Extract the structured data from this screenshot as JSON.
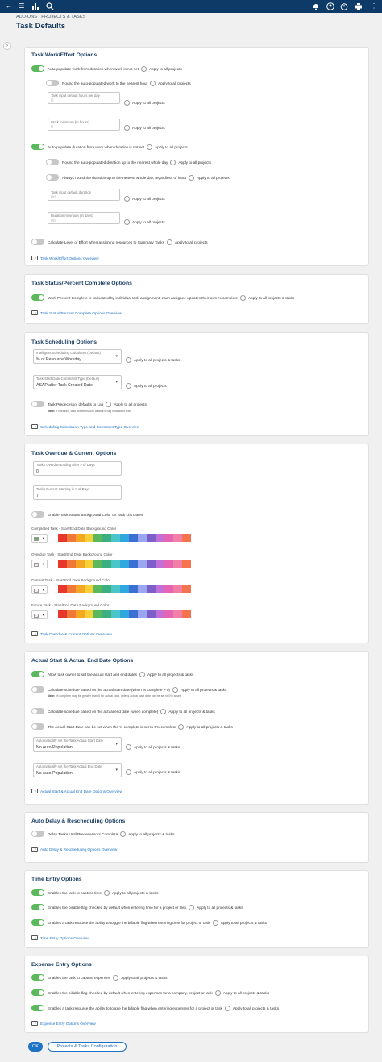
{
  "header": {
    "breadcrumb": "ADD-ONS · PROJECTS & TASKS",
    "title": "Task Defaults"
  },
  "apply_all": "Apply to all projects",
  "apply_all_tasks": "Apply to all projects & tasks",
  "work_effort": {
    "title": "Task Work/Effort Options",
    "auto_work": "Auto-populate work from duration when work is not set",
    "round_work": "Round the auto-populated work to the nearest hour",
    "hours_per_day_label": "Task input default hours per day",
    "hours_per_day_value": "8",
    "work_min_label": "Work minimum (in hours)",
    "work_min_value": "0",
    "auto_duration": "Auto-populate duration from work when duration is not set",
    "round_duration": "Round the auto-populated duration up to the nearest whole day",
    "always_round": "Always round the duration up to the nearest whole day, regardless of input",
    "default_duration_label": "Task input default duration",
    "default_duration_value": "0d",
    "duration_min_label": "Duration minimum (in days)",
    "duration_min_value": "0d",
    "loe": "Calculate Level of Effort when assigning resources to Summary Tasks",
    "overview": "Task Work/Effort Options Overview"
  },
  "status": {
    "title": "Task Status/Percent Complete Options",
    "work_percent": "Work Percent Complete is calculated by individual task assignment, each assignee updates their own % complete",
    "overview": "Task Status/Percent Complete Options Overview"
  },
  "scheduling": {
    "title": "Task Scheduling Options",
    "calc_label": "Intelligent Scheduling Calculates (Default)",
    "calc_value": "% of Resource Workday",
    "constraint_label": "Task Start Date Constraint Type (Default)",
    "constraint_value": "ASAP after Task Created Date",
    "predecessor": "Task Predecessor defaults to Lag",
    "note_label": "Note:",
    "note_text": "If checked, task predecessors default to lag instead of lead",
    "overview": "Scheduling Calculation Type and Constraint Type Overview"
  },
  "overdue": {
    "title": "Task Overdue & Current Options",
    "overdue_label": "Tasks Overdue Ending After # of Days",
    "overdue_value": "0",
    "current_label": "Tasks Current Starting in # of Days",
    "current_value": "7",
    "bg_color": "Enable Task Status Background Color on Task List Dates",
    "completed_label": "Completed Task - Start/End Date Background Color",
    "overdue_color_label": "Overdue Task - Start/End Date Background Color",
    "current_color_label": "Current Task - Start/End Date Background Color",
    "future_color_label": "Future Task - Start/End Date Background Color",
    "completed_color": "#5cb85c",
    "palette": [
      "#e8372c",
      "#f0793a",
      "#f5a623",
      "#f7d038",
      "#5cb85c",
      "#3aaf7f",
      "#4ac6c9",
      "#2fa8e0",
      "#3b6fd4",
      "#9aa7f0",
      "#7d5fc9",
      "#c36fd8",
      "#e664b4",
      "#f07ea7",
      "#f5734f"
    ],
    "overview": "Task Overdue & Current Options Overview"
  },
  "actual_dates": {
    "title": "Actual Start & Actual End Date Options",
    "allow_owner": "Allow task owner to set the actual start and end dates",
    "calc_start": "Calculate schedule based on the actual start date (when % complete > 0)",
    "note_label": "Note:",
    "note_text": "% complete may be greater than 0 for actual start, unless actual start date can be set to 0% is set",
    "calc_end": "Calculate schedule based on the actual end date (when complete)",
    "zero_complete": "The Actual Start Date can be set when the % complete is set to 0% complete",
    "auto_start_label": "Automatically set the Task Actual Start Date",
    "auto_start_value": "No Auto-Population",
    "auto_end_label": "Automatically set the Task Actual End Date",
    "auto_end_value": "No Auto-Population",
    "overview": "Actual Start & Actual End Date Options Overview"
  },
  "auto_delay": {
    "title": "Auto Delay & Rescheduling Options",
    "delay": "Delay Tasks Until Predecessors Complete",
    "overview": "Auto Delay & Rescheduling Options Overview"
  },
  "time_entry": {
    "title": "Time Entry Options",
    "capture": "Enables the task to capture time",
    "billable": "Enables the billable flag checked by default when entering time for a project or task",
    "toggle": "Enables a task resource the ability to toggle the billable flag when entering time for project or task",
    "overview": "Time Entry Options Overview"
  },
  "expense_entry": {
    "title": "Expense Entry Options",
    "capture": "Enables the task to capture expenses",
    "billable": "Enables the billable flag checked by default when entering expenses for a company, project or task",
    "toggle": "Enables a task resource the ability to toggle the billable flag when entering expenses for a project or task",
    "overview": "Expense Entry Options Overview"
  },
  "footer": {
    "ok": "OK",
    "config": "Projects & Tasks Configuration"
  }
}
